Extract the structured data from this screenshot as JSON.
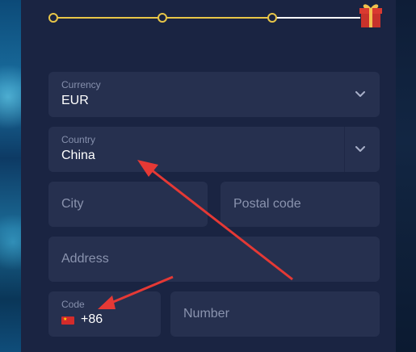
{
  "colors": {
    "background": "#1a2442",
    "field": "#26304f",
    "accent_gold": "#e7c548",
    "annotation_arrow": "#e53935"
  },
  "progress": {
    "steps_completed": 3,
    "reward_icon": "gift-icon"
  },
  "form": {
    "currency": {
      "label": "Currency",
      "value": "EUR",
      "icon": "chevron-down-icon"
    },
    "country": {
      "label": "Country",
      "value": "China",
      "icon": "chevron-down-icon"
    },
    "city": {
      "placeholder": "City"
    },
    "postal_code": {
      "placeholder": "Postal code"
    },
    "address": {
      "placeholder": "Address"
    },
    "code": {
      "label": "Code",
      "value": "+86",
      "flag_icon": "china-flag-icon"
    },
    "number": {
      "placeholder": "Number"
    }
  }
}
